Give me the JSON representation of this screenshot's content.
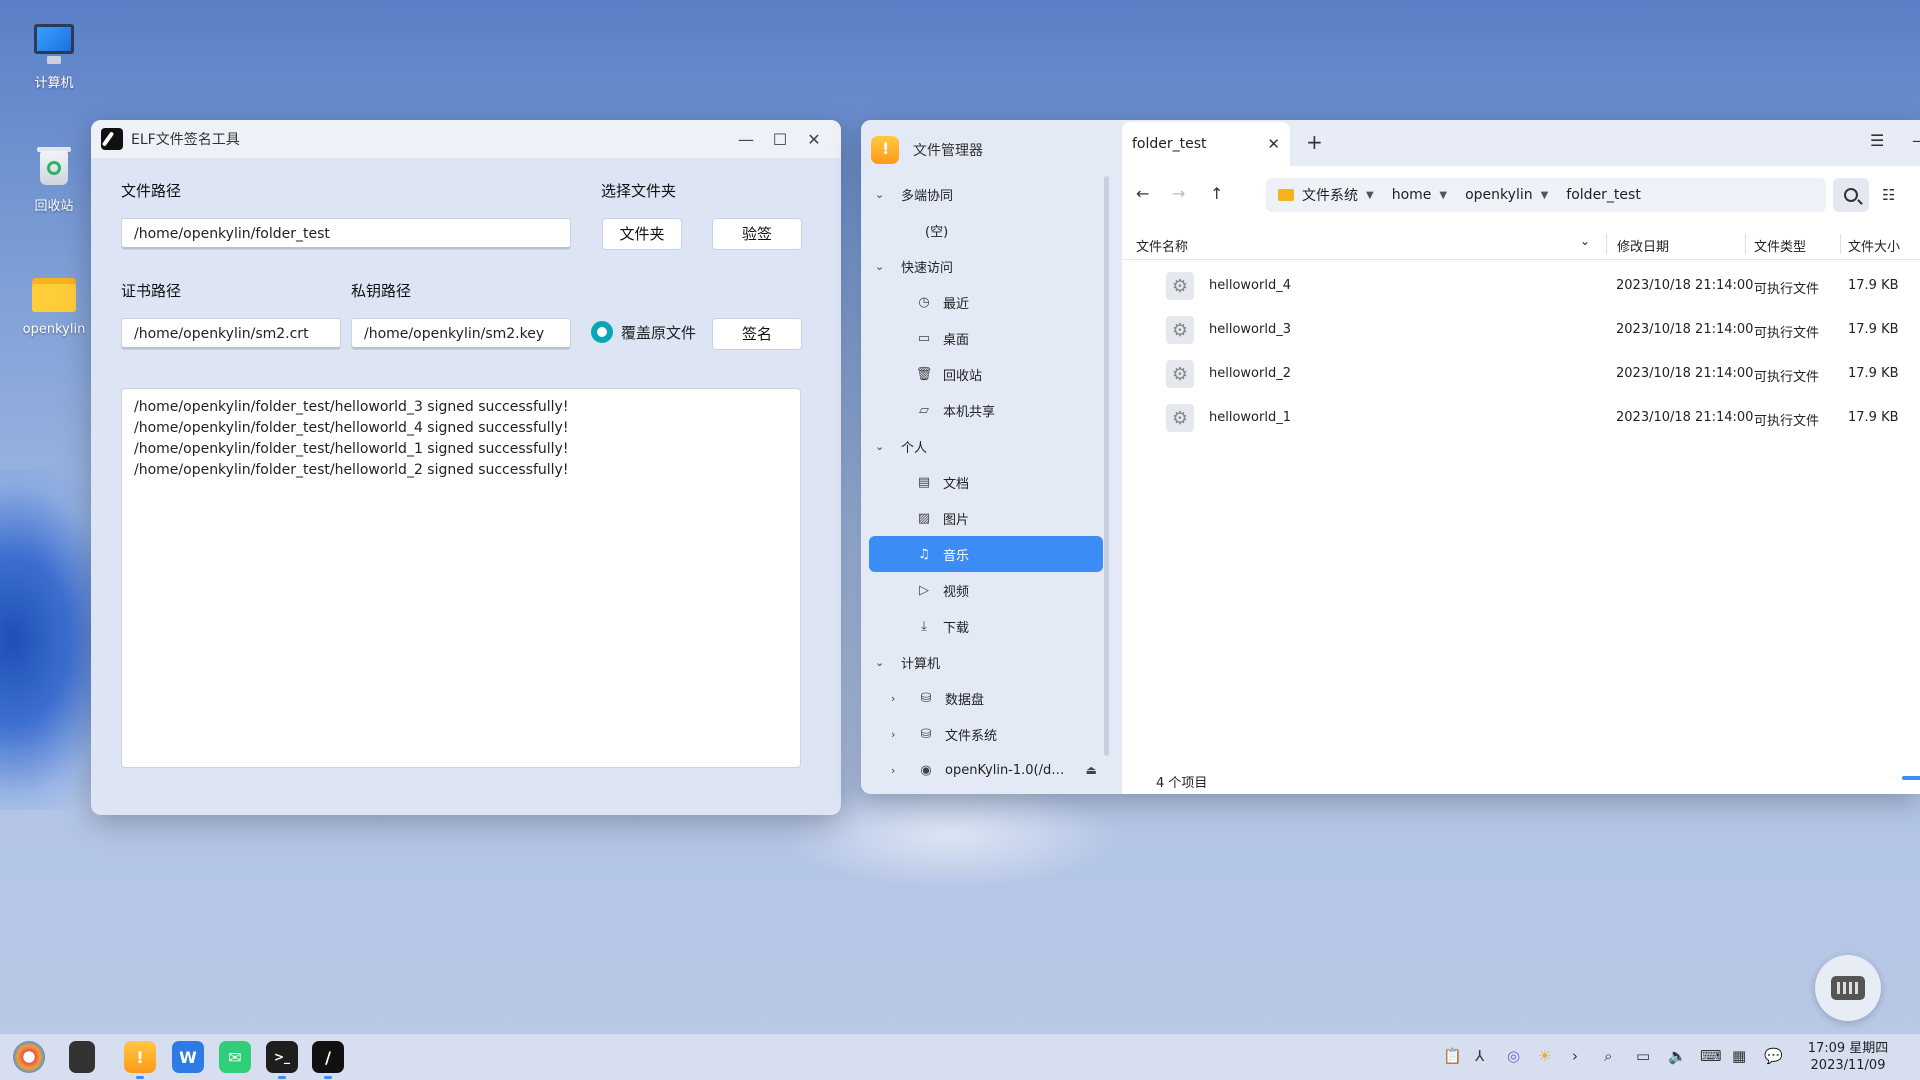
{
  "desktop": {
    "icons": [
      {
        "label": "计算机"
      },
      {
        "label": "回收站"
      },
      {
        "label": "openkylin"
      }
    ]
  },
  "elf_window": {
    "title": "ELF文件签名工具",
    "file_path_label": "文件路径",
    "file_path_value": "/home/openkylin/folder_test",
    "select_folder_label": "选择文件夹",
    "folder_button": "文件夹",
    "verify_button": "验签",
    "cert_path_label": "证书路径",
    "cert_path_value": "/home/openkylin/sm2.crt",
    "key_path_label": "私钥路径",
    "key_path_value": "/home/openkylin/sm2.key",
    "overwrite_label": "覆盖原文件",
    "sign_button": "签名",
    "log_lines": [
      "/home/openkylin/folder_test/helloworld_3 signed successfully!",
      "/home/openkylin/folder_test/helloworld_4 signed successfully!",
      "/home/openkylin/folder_test/helloworld_1 signed successfully!",
      "/home/openkylin/folder_test/helloworld_2 signed successfully!"
    ]
  },
  "file_manager": {
    "app_title": "文件管理器",
    "sidebar": {
      "groups": [
        {
          "label": "多端协同",
          "children": [
            {
              "label": "(空)",
              "icon": ""
            }
          ]
        },
        {
          "label": "快速访问",
          "children": [
            {
              "label": "最近",
              "icon": "clock-icon"
            },
            {
              "label": "桌面",
              "icon": "desktop-icon"
            },
            {
              "label": "回收站",
              "icon": "trash-icon"
            },
            {
              "label": "本机共享",
              "icon": "folder-icon"
            }
          ]
        },
        {
          "label": "个人",
          "children": [
            {
              "label": "文档",
              "icon": "document-icon"
            },
            {
              "label": "图片",
              "icon": "image-icon"
            },
            {
              "label": "音乐",
              "icon": "music-icon"
            },
            {
              "label": "视频",
              "icon": "video-icon"
            },
            {
              "label": "下载",
              "icon": "download-icon"
            }
          ]
        },
        {
          "label": "计算机",
          "children": [
            {
              "label": "数据盘",
              "icon": "drive-icon"
            },
            {
              "label": "文件系统",
              "icon": "drive-icon"
            },
            {
              "label": "openKylin-1.0(/d…",
              "icon": "disc-icon"
            }
          ]
        }
      ]
    },
    "tab_label": "folder_test",
    "path_segments": [
      "文件系统",
      "home",
      "openkylin",
      "folder_test"
    ],
    "columns": [
      "文件名称",
      "修改日期",
      "文件类型",
      "文件大小"
    ],
    "rows": [
      {
        "name": "helloworld_4",
        "date": "2023/10/18 21:14:00",
        "type": "可执行文件",
        "size": "17.9 KB"
      },
      {
        "name": "helloworld_3",
        "date": "2023/10/18 21:14:00",
        "type": "可执行文件",
        "size": "17.9 KB"
      },
      {
        "name": "helloworld_2",
        "date": "2023/10/18 21:14:00",
        "type": "可执行文件",
        "size": "17.9 KB"
      },
      {
        "name": "helloworld_1",
        "date": "2023/10/18 21:14:00",
        "type": "可执行文件",
        "size": "17.9 KB"
      }
    ],
    "status": "4 个项目"
  },
  "taskbar": {
    "time": "17:09 星期四",
    "date": "2023/11/09"
  },
  "colors": {
    "accent": "#3b8cf5",
    "radio": "#0aa6b8"
  }
}
